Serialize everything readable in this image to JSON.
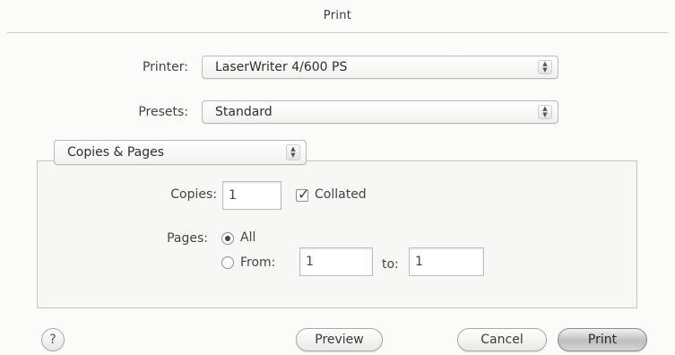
{
  "dialog": {
    "title": "Print"
  },
  "printer": {
    "label": "Printer:",
    "value": "LaserWriter 4/600 PS"
  },
  "presets": {
    "label": "Presets:",
    "value": "Standard"
  },
  "section": {
    "value": "Copies & Pages"
  },
  "copies": {
    "label": "Copies:",
    "value": "1",
    "collated_label": "Collated",
    "collated": true
  },
  "pages": {
    "label": "Pages:",
    "all_label": "All",
    "from_label": "From:",
    "from_value": "1",
    "to_label": "to:",
    "to_value": "1",
    "selected": "All"
  },
  "buttons": {
    "help": "?",
    "preview": "Preview",
    "cancel": "Cancel",
    "print": "Print"
  },
  "icons": {
    "popup_arrows": "updown-chevron-icon",
    "check": "checkmark-icon",
    "help": "help-icon"
  }
}
